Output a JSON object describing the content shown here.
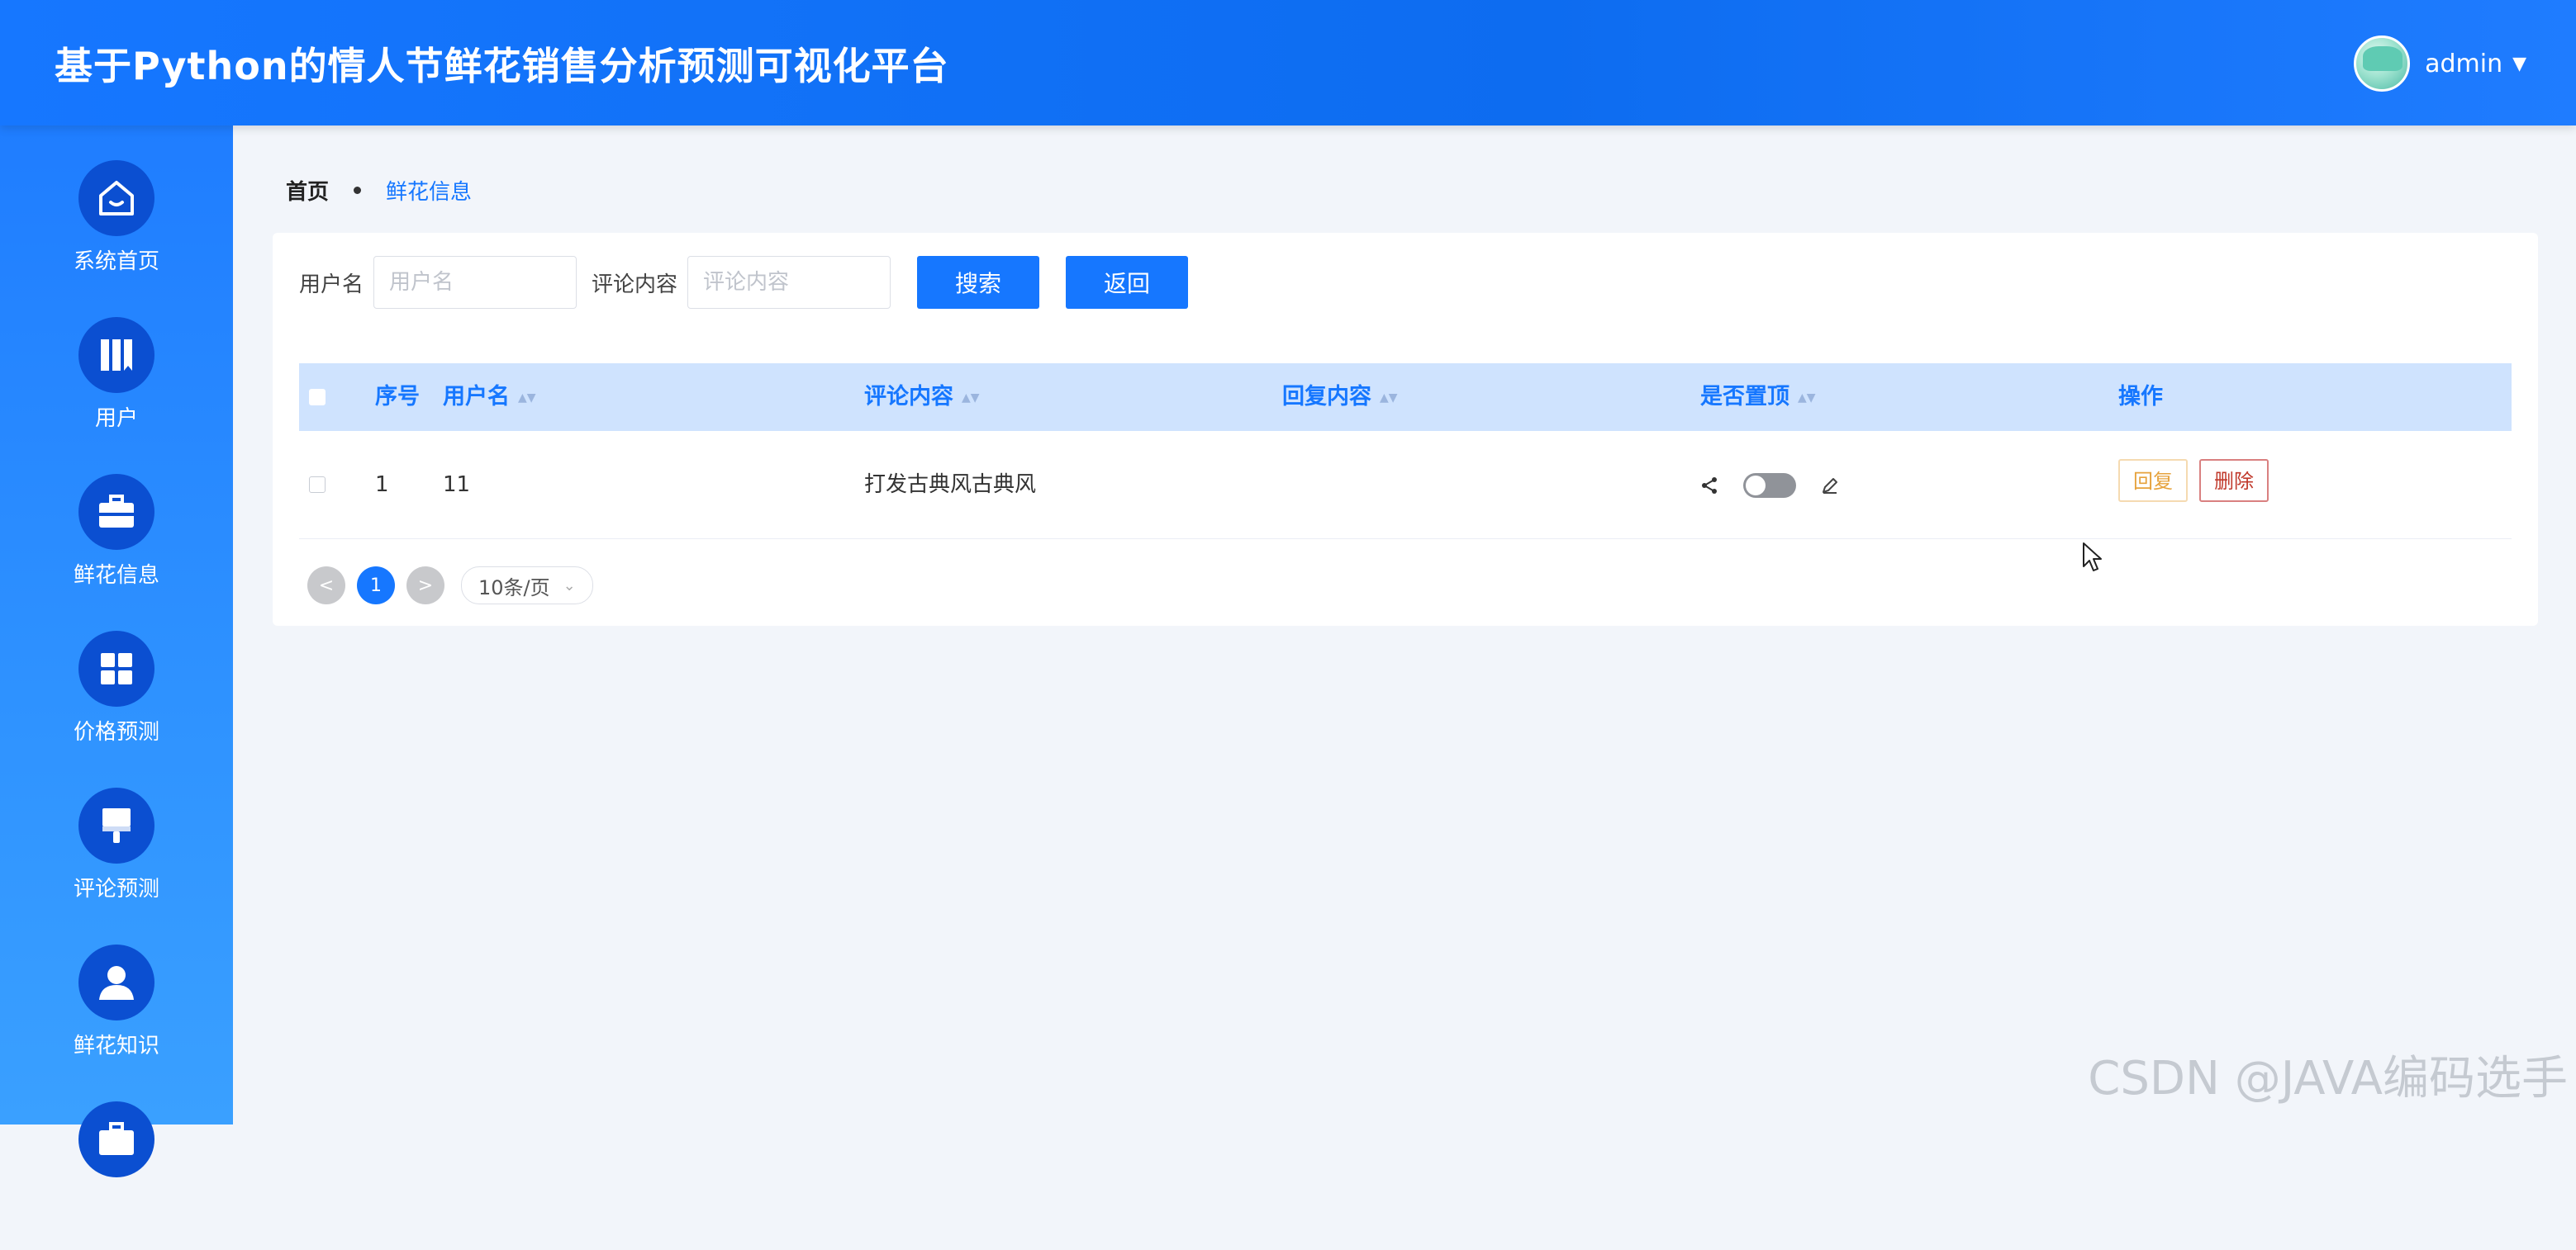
{
  "header": {
    "title": "基于Python的情人节鲜花销售分析预测可视化平台",
    "user": {
      "name": "admin",
      "dropdown_icon": "caret-down-icon"
    }
  },
  "sidebar": {
    "items": [
      {
        "label": "系统首页",
        "icon": "home-icon"
      },
      {
        "label": "用户",
        "icon": "book-icon"
      },
      {
        "label": "鲜花信息",
        "icon": "briefcase-icon"
      },
      {
        "label": "价格预测",
        "icon": "grid-icon"
      },
      {
        "label": "评论预测",
        "icon": "paint-brush-icon"
      },
      {
        "label": "鲜花知识",
        "icon": "user-icon"
      }
    ]
  },
  "breadcrumb": {
    "home": "首页",
    "current": "鲜花信息"
  },
  "search": {
    "username_label": "用户名",
    "username_placeholder": "用户名",
    "username_value": "",
    "comment_label": "评论内容",
    "comment_placeholder": "评论内容",
    "comment_value": "",
    "search_label": "搜索",
    "back_label": "返回"
  },
  "table": {
    "headers": {
      "index": "序号",
      "username": "用户名",
      "comment": "评论内容",
      "reply": "回复内容",
      "pinned": "是否置顶",
      "actions": "操作"
    },
    "rows": [
      {
        "index": "1",
        "username": "11",
        "comment": "打发古典风古典风",
        "reply": "",
        "pinned": false,
        "reply_label": "回复",
        "delete_label": "删除"
      }
    ]
  },
  "pagination": {
    "prev": "<",
    "current": "1",
    "next": ">",
    "page_size": "10条/页"
  },
  "watermark": "CSDN @JAVA编码选手",
  "colors": {
    "primary": "#1677ff",
    "sidebar_icon_bg": "#0b4fd1",
    "table_header_bg": "#cfe3fe",
    "reply_text": "#e6a23c",
    "delete_text": "#c0392b"
  }
}
